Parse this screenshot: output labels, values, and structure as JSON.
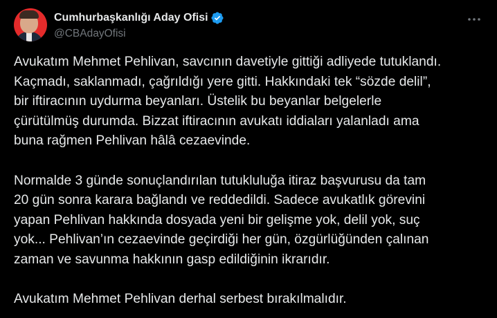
{
  "author": {
    "display_name": "Cumhurbaşkanlığı Aday Ofisi",
    "handle": "@CBAdayOfisi",
    "verified_icon": "verified-badge-icon",
    "avatar_icon": "avatar"
  },
  "menu": {
    "icon": "more-dots-icon"
  },
  "colors": {
    "background": "#000000",
    "text": "#e7e9ea",
    "secondary_text": "#71767b",
    "verified_blue": "#1d9bf0",
    "avatar_red": "#e42b2b"
  },
  "tweet": {
    "paragraphs": [
      {
        "lines": [
          "Avukatım Mehmet Pehlivan, savcının davetiyle gittiği adliyede tutuklandı.",
          "Kaçmadı, saklanmadı, çağrıldığı yere gitti. Hakkındaki tek “sözde delil”,",
          "bir iftiracının uydurma beyanları. Üstelik bu beyanlar belgelerle",
          "çürütülmüş durumda. Bizzat iftiracının avukatı iddiaları yalanladı ama",
          "buna rağmen Pehlivan hâlâ cezaevinde."
        ]
      },
      {
        "lines": [
          "Normalde 3 günde sonuçlandırılan tutukluluğa itiraz başvurusu da tam",
          "20 gün sonra karara bağlandı ve reddedildi. Sadece avukatlık görevini",
          "yapan Pehlivan hakkında dosyada yeni bir gelişme yok, delil yok, suç",
          "yok... Pehlivan’ın cezaevinde geçirdiği her gün, özgürlüğünden çalınan",
          "zaman ve savunma hakkının gasp edildiğinin ikrarıdır."
        ]
      },
      {
        "lines": [
          "Avukatım Mehmet Pehlivan derhal serbest bırakılmalıdır."
        ]
      }
    ]
  }
}
